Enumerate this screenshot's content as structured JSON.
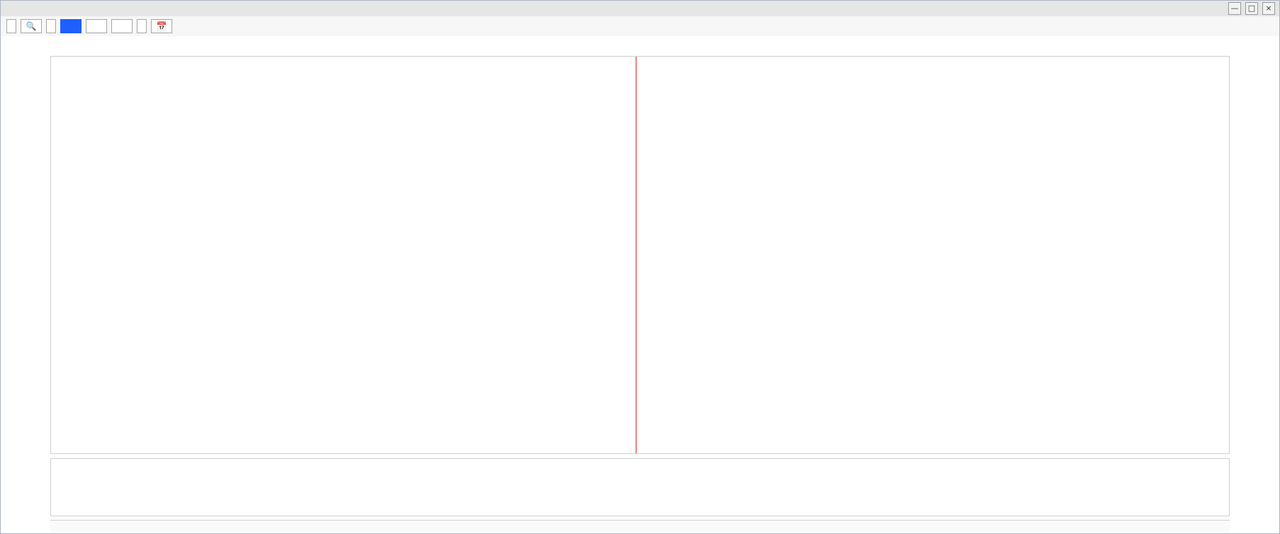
{
  "window": {
    "title": ""
  },
  "toolbar": {
    "items": []
  },
  "info": {
    "items": []
  },
  "legend": {
    "items": []
  },
  "chart_data": {
    "type": "table",
    "title": "",
    "xlabel": "",
    "ylabel": "",
    "categories": [],
    "series": [],
    "ylim": [],
    "grid": true,
    "legend_position": "top-left"
  }
}
